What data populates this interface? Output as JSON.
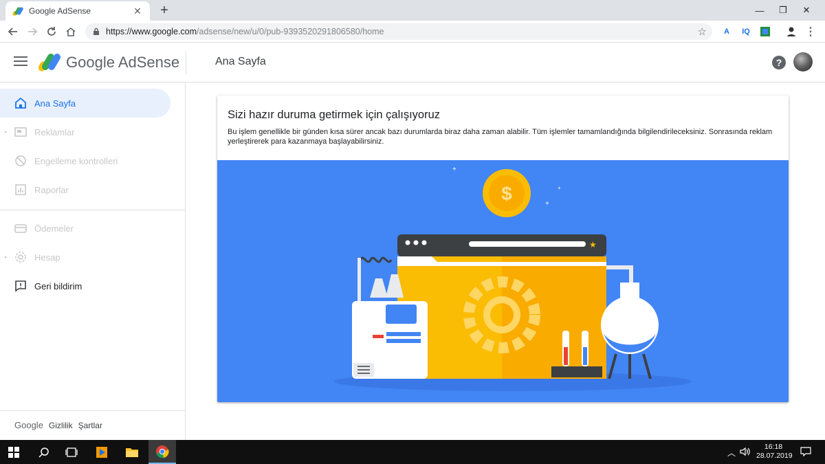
{
  "browser": {
    "tab_title": "Google AdSense",
    "tab_close": "✕",
    "new_tab": "+",
    "url_host": "https://www.google.com",
    "url_path": "/adsense/new/u/0/pub-9393520291806580/home",
    "ext_iq": "IQ",
    "window": {
      "minimize": "—",
      "restore": "❐",
      "close": "✕"
    }
  },
  "header": {
    "brand": "Google AdSense",
    "page_title": "Ana Sayfa",
    "help_label": "?"
  },
  "sidebar": {
    "items": [
      {
        "label": "Ana Sayfa",
        "icon": "home-icon",
        "active": true
      },
      {
        "label": "Reklamlar",
        "icon": "ads-icon",
        "disabled": true
      },
      {
        "label": "Engelleme kontrolleri",
        "icon": "block-icon",
        "disabled": true
      },
      {
        "label": "Raporlar",
        "icon": "reports-icon",
        "disabled": true
      },
      {
        "label": "Ödemeler",
        "icon": "payments-icon",
        "disabled": true
      },
      {
        "label": "Hesap",
        "icon": "account-gear-icon",
        "disabled": true
      },
      {
        "label": "Geri bildirim",
        "icon": "feedback-icon"
      }
    ],
    "footer": {
      "google": "Google",
      "privacy": "Gizlilik",
      "terms": "Şartlar"
    }
  },
  "card": {
    "title": "Sizi hazır duruma getirmek için çalışıyoruz",
    "body": "Bu işlem genellikle bir günden kısa sürer ancak bazı durumlarda biraz daha zaman alabilir. Tüm işlemler tamamlandığında bilgilendirileceksiniz. Sonrasında reklam yerleştirerek para kazanmaya başlayabilirsiniz."
  },
  "taskbar": {
    "time": "16:18",
    "date": "28.07.2019"
  },
  "colors": {
    "accent": "#1a73e8",
    "illustration_bg": "#4285f4",
    "coin": "#fbbc04",
    "window_orange": "#f9ab00"
  }
}
